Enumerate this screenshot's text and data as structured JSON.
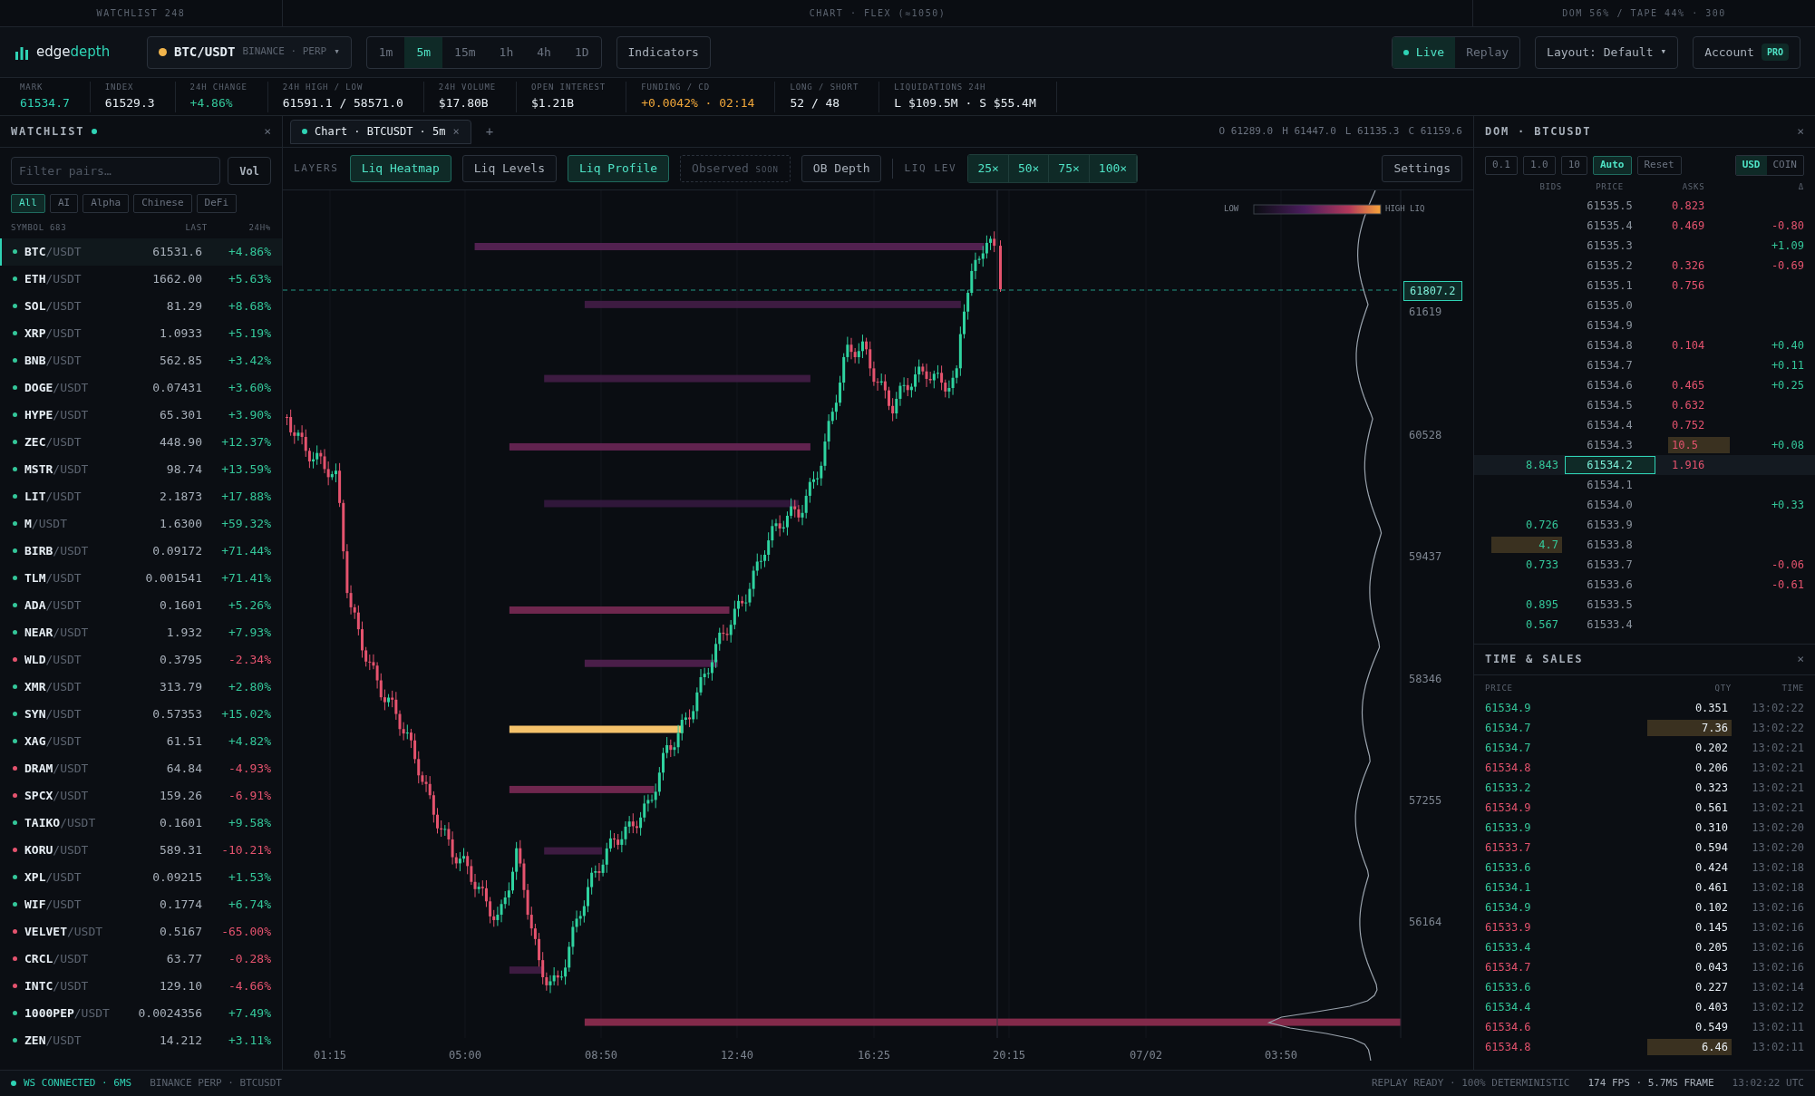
{
  "top_strip": [
    "WATCHLIST 248",
    "CHART · FLEX (≈1050)",
    "DOM 56% / TAPE 44% · 300"
  ],
  "header": {
    "logo": {
      "part_1": "edge",
      "part_2": "depth"
    },
    "symbol": {
      "pair": "BTC/USDT",
      "venue": "BINANCE · PERP",
      "caret": "▾"
    },
    "timeframes": [
      {
        "label": "1m",
        "selected": false
      },
      {
        "label": "5m",
        "selected": true
      },
      {
        "label": "15m",
        "selected": false
      },
      {
        "label": "1h",
        "selected": false
      },
      {
        "label": "4h",
        "selected": false
      },
      {
        "label": "1D",
        "selected": false
      }
    ],
    "indicators": "Indicators",
    "modes": [
      {
        "label": "Live",
        "selected": true
      },
      {
        "label": "Replay",
        "selected": false
      }
    ],
    "layout": "Layout: Default",
    "layout_caret": "▾",
    "account": "Account",
    "account_badge": "PRO"
  },
  "stats": [
    {
      "label": "MARK",
      "value": "61534.7",
      "color": "#2fd3b5"
    },
    {
      "label": "INDEX",
      "value": "61529.3",
      "color": "#e6edf3"
    },
    {
      "label": "24H CHANGE",
      "value": "+4.86%",
      "color": "#34c79a"
    },
    {
      "label": "24H HIGH / LOW",
      "value": "61591.1 / 58571.0",
      "color": "#e6edf3"
    },
    {
      "label": "24H VOLUME",
      "value": "$17.80B",
      "color": "#e6edf3"
    },
    {
      "label": "OPEN INTEREST",
      "value": "$1.21B",
      "color": "#e6edf3"
    },
    {
      "label": "FUNDING / CD",
      "value": "+0.0042% · 02:14",
      "color": "#f0a73a"
    },
    {
      "label": "LONG / SHORT",
      "value": "52 / 48",
      "color": "#e6edf3"
    },
    {
      "label": "LIQUIDATIONS 24H",
      "value": "L $109.5M · S $55.4M",
      "color": "#e6edf3"
    }
  ],
  "watchlist": {
    "title": "WATCHLIST",
    "close": "×",
    "filter": {
      "placeholder": "Filter pairs…"
    },
    "sort_button": "Vol",
    "chips": [
      {
        "label": "All",
        "selected": true
      },
      {
        "label": "AI",
        "selected": false
      },
      {
        "label": "Alpha",
        "selected": false
      },
      {
        "label": "Chinese",
        "selected": false
      },
      {
        "label": "DeFi",
        "selected": false
      }
    ],
    "columns": [
      "SYMBOL 683",
      "LAST",
      "24H%"
    ],
    "rows": [
      {
        "base": "BTC",
        "quote": "/USDT",
        "last": "61531.6",
        "change": "+4.86%",
        "color": "#34c79a",
        "selected": true
      },
      {
        "base": "ETH",
        "quote": "/USDT",
        "last": "1662.00",
        "change": "+5.63%",
        "color": "#34c79a",
        "selected": false
      },
      {
        "base": "SOL",
        "quote": "/USDT",
        "last": "81.29",
        "change": "+8.68%",
        "color": "#34c79a",
        "selected": false
      },
      {
        "base": "XRP",
        "quote": "/USDT",
        "last": "1.0933",
        "change": "+5.19%",
        "color": "#34c79a",
        "selected": false
      },
      {
        "base": "BNB",
        "quote": "/USDT",
        "last": "562.85",
        "change": "+3.42%",
        "color": "#34c79a",
        "selected": false
      },
      {
        "base": "DOGE",
        "quote": "/USDT",
        "last": "0.07431",
        "change": "+3.60%",
        "color": "#34c79a",
        "selected": false
      },
      {
        "base": "HYPE",
        "quote": "/USDT",
        "last": "65.301",
        "change": "+3.90%",
        "color": "#34c79a",
        "selected": false
      },
      {
        "base": "ZEC",
        "quote": "/USDT",
        "last": "448.90",
        "change": "+12.37%",
        "color": "#34c79a",
        "selected": false
      },
      {
        "base": "MSTR",
        "quote": "/USDT",
        "last": "98.74",
        "change": "+13.59%",
        "color": "#34c79a",
        "selected": false
      },
      {
        "base": "LIT",
        "quote": "/USDT",
        "last": "2.1873",
        "change": "+17.88%",
        "color": "#34c79a",
        "selected": false
      },
      {
        "base": "M",
        "quote": "/USDT",
        "last": "1.6300",
        "change": "+59.32%",
        "color": "#34c79a",
        "selected": false
      },
      {
        "base": "BIRB",
        "quote": "/USDT",
        "last": "0.09172",
        "change": "+71.44%",
        "color": "#34c79a",
        "selected": false
      },
      {
        "base": "TLM",
        "quote": "/USDT",
        "last": "0.001541",
        "change": "+71.41%",
        "color": "#34c79a",
        "selected": false
      },
      {
        "base": "ADA",
        "quote": "/USDT",
        "last": "0.1601",
        "change": "+5.26%",
        "color": "#34c79a",
        "selected": false
      },
      {
        "base": "NEAR",
        "quote": "/USDT",
        "last": "1.932",
        "change": "+7.93%",
        "color": "#34c79a",
        "selected": false
      },
      {
        "base": "WLD",
        "quote": "/USDT",
        "last": "0.3795",
        "change": "-2.34%",
        "color": "#e5536e",
        "selected": false
      },
      {
        "base": "XMR",
        "quote": "/USDT",
        "last": "313.79",
        "change": "+2.80%",
        "color": "#34c79a",
        "selected": false
      },
      {
        "base": "SYN",
        "quote": "/USDT",
        "last": "0.57353",
        "change": "+15.02%",
        "color": "#34c79a",
        "selected": false
      },
      {
        "base": "XAG",
        "quote": "/USDT",
        "last": "61.51",
        "change": "+4.82%",
        "color": "#34c79a",
        "selected": false
      },
      {
        "base": "DRAM",
        "quote": "/USDT",
        "last": "64.84",
        "change": "-4.93%",
        "color": "#e5536e",
        "selected": false
      },
      {
        "base": "SPCX",
        "quote": "/USDT",
        "last": "159.26",
        "change": "-6.91%",
        "color": "#e5536e",
        "selected": false
      },
      {
        "base": "TAIKO",
        "quote": "/USDT",
        "last": "0.1601",
        "change": "+9.58%",
        "color": "#34c79a",
        "selected": false
      },
      {
        "base": "KORU",
        "quote": "/USDT",
        "last": "589.31",
        "change": "-10.21%",
        "color": "#e5536e",
        "selected": false
      },
      {
        "base": "XPL",
        "quote": "/USDT",
        "last": "0.09215",
        "change": "+1.53%",
        "color": "#34c79a",
        "selected": false
      },
      {
        "base": "WIF",
        "quote": "/USDT",
        "last": "0.1774",
        "change": "+6.74%",
        "color": "#34c79a",
        "selected": false
      },
      {
        "base": "VELVET",
        "quote": "/USDT",
        "last": "0.5167",
        "change": "-65.00%",
        "color": "#e5536e",
        "selected": false
      },
      {
        "base": "CRCL",
        "quote": "/USDT",
        "last": "63.77",
        "change": "-0.28%",
        "color": "#e5536e",
        "selected": false
      },
      {
        "base": "INTC",
        "quote": "/USDT",
        "last": "129.10",
        "change": "-4.66%",
        "color": "#e5536e",
        "selected": false
      },
      {
        "base": "1000PEP",
        "quote": "/USDT",
        "last": "0.0024356",
        "change": "+7.49%",
        "color": "#34c79a",
        "selected": false
      },
      {
        "base": "ZEN",
        "quote": "/USDT",
        "last": "14.212",
        "change": "+3.11%",
        "color": "#34c79a",
        "selected": false
      }
    ]
  },
  "chart": {
    "tab": {
      "label": "Chart · BTCUSDT · 5m",
      "close": "×"
    },
    "add_tab": "+",
    "ohlc": [
      "O 61289.0",
      "H 61447.0",
      "L 61135.3",
      "C 61159.6"
    ],
    "layers_label": "LAYERS",
    "layers": [
      {
        "label": "Liq Heatmap",
        "kind": "toggle",
        "on": true
      },
      {
        "label": "Liq Levels",
        "kind": "toggle",
        "on": false
      },
      {
        "label": "Liq Profile",
        "kind": "toggle",
        "on": true
      },
      {
        "label": "Observed",
        "kind": "soon",
        "badge": "SOON",
        "on": false
      },
      {
        "label": "OB Depth",
        "kind": "toggle",
        "on": false
      }
    ],
    "leverage_label": "LIQ LEV",
    "leverage": [
      {
        "label": "25×",
        "on": true
      },
      {
        "label": "50×",
        "on": true
      },
      {
        "label": "75×",
        "on": true
      },
      {
        "label": "100×",
        "on": true
      }
    ],
    "settings": "Settings",
    "legend": {
      "low": "LOW",
      "high": "HIGH LIQ"
    },
    "price_tag": "61807.2",
    "price_axis": [
      "61619",
      "60528",
      "59437",
      "58346",
      "57255",
      "56164"
    ],
    "time_axis": [
      "01:15",
      "05:00",
      "08:50",
      "12:40",
      "16:25",
      "20:15",
      "07/02",
      "03:50"
    ]
  },
  "dom": {
    "title": "DOM · BTCUSDT",
    "close": "×",
    "steps": [
      {
        "label": "0.1",
        "selected": false
      },
      {
        "label": "1.0",
        "selected": false
      },
      {
        "label": "10",
        "selected": false
      },
      {
        "label": "Auto",
        "selected": true
      }
    ],
    "reset": "Reset",
    "units": [
      {
        "label": "USD",
        "selected": true
      },
      {
        "label": "COIN",
        "selected": false
      }
    ],
    "columns": [
      "BIDS",
      "PRICE",
      "ASKS",
      "Δ"
    ],
    "rows": [
      {
        "price": "61535.5",
        "ask": "0.823",
        "large": false,
        "selected": false
      },
      {
        "price": "61535.4",
        "ask": "0.469",
        "delta": "-0.80",
        "color": "#e5536e",
        "large": false,
        "selected": false
      },
      {
        "price": "61535.3",
        "delta": "+1.09",
        "color": "#34c79a",
        "selected": false
      },
      {
        "price": "61535.2",
        "ask": "0.326",
        "delta": "-0.69",
        "color": "#e5536e",
        "large": false,
        "selected": false
      },
      {
        "price": "61535.1",
        "ask": "0.756",
        "large": false,
        "selected": false
      },
      {
        "price": "61535.0",
        "selected": false
      },
      {
        "price": "61534.9",
        "selected": false
      },
      {
        "price": "61534.8",
        "ask": "0.104",
        "delta": "+0.40",
        "color": "#34c79a",
        "large": false,
        "selected": false
      },
      {
        "price": "61534.7",
        "delta": "+0.11",
        "color": "#34c79a",
        "selected": false
      },
      {
        "price": "61534.6",
        "ask": "0.465",
        "delta": "+0.25",
        "color": "#34c79a",
        "large": false,
        "selected": false
      },
      {
        "price": "61534.5",
        "ask": "0.632",
        "large": false,
        "selected": false
      },
      {
        "price": "61534.4",
        "ask": "0.752",
        "large": false,
        "selected": false
      },
      {
        "price": "61534.3",
        "ask": "10.5",
        "delta": "+0.08",
        "color": "#34c79a",
        "large": true,
        "selected": false
      },
      {
        "price": "61534.2",
        "bid": "8.843",
        "ask": "1.916",
        "large": false,
        "selected": true
      },
      {
        "price": "61534.1",
        "selected": false
      },
      {
        "price": "61534.0",
        "delta": "+0.33",
        "color": "#34c79a",
        "selected": false
      },
      {
        "price": "61533.9",
        "bid": "0.726",
        "large": false,
        "selected": false
      },
      {
        "price": "61533.8",
        "bid": "4.7",
        "large": true,
        "selected": false
      },
      {
        "price": "61533.7",
        "bid": "0.733",
        "delta": "-0.06",
        "color": "#e5536e",
        "large": false,
        "selected": false
      },
      {
        "price": "61533.6",
        "delta": "-0.61",
        "color": "#e5536e",
        "selected": false
      },
      {
        "price": "61533.5",
        "bid": "0.895",
        "large": false,
        "selected": false
      },
      {
        "price": "61533.4",
        "bid": "0.567",
        "large": false,
        "selected": false
      }
    ]
  },
  "time_sales": {
    "title": "TIME & SALES",
    "close": "×",
    "columns": [
      "PRICE",
      "QTY",
      "TIME"
    ],
    "rows": [
      {
        "price": "61534.9",
        "qty": "0.351",
        "time": "13:02:22",
        "color": "#34c79a",
        "large": false
      },
      {
        "price": "61534.7",
        "qty": "7.36",
        "time": "13:02:22",
        "color": "#34c79a",
        "large": true
      },
      {
        "price": "61534.7",
        "qty": "0.202",
        "time": "13:02:21",
        "color": "#34c79a",
        "large": false
      },
      {
        "price": "61534.8",
        "qty": "0.206",
        "time": "13:02:21",
        "color": "#e5536e",
        "large": false
      },
      {
        "price": "61533.2",
        "qty": "0.323",
        "time": "13:02:21",
        "color": "#34c79a",
        "large": false
      },
      {
        "price": "61534.9",
        "qty": "0.561",
        "time": "13:02:21",
        "color": "#e5536e",
        "large": false
      },
      {
        "price": "61533.9",
        "qty": "0.310",
        "time": "13:02:20",
        "color": "#34c79a",
        "large": false
      },
      {
        "price": "61533.7",
        "qty": "0.594",
        "time": "13:02:20",
        "color": "#e5536e",
        "large": false
      },
      {
        "price": "61533.6",
        "qty": "0.424",
        "time": "13:02:18",
        "color": "#34c79a",
        "large": false
      },
      {
        "price": "61534.1",
        "qty": "0.461",
        "time": "13:02:18",
        "color": "#34c79a",
        "large": false
      },
      {
        "price": "61534.9",
        "qty": "0.102",
        "time": "13:02:16",
        "color": "#34c79a",
        "large": false
      },
      {
        "price": "61533.9",
        "qty": "0.145",
        "time": "13:02:16",
        "color": "#e5536e",
        "large": false
      },
      {
        "price": "61533.4",
        "qty": "0.205",
        "time": "13:02:16",
        "color": "#34c79a",
        "large": false
      },
      {
        "price": "61534.7",
        "qty": "0.043",
        "time": "13:02:16",
        "color": "#e5536e",
        "large": false
      },
      {
        "price": "61533.6",
        "qty": "0.227",
        "time": "13:02:14",
        "color": "#34c79a",
        "large": false
      },
      {
        "price": "61534.4",
        "qty": "0.403",
        "time": "13:02:12",
        "color": "#34c79a",
        "large": false
      },
      {
        "price": "61534.6",
        "qty": "0.549",
        "time": "13:02:11",
        "color": "#e5536e",
        "large": false
      },
      {
        "price": "61534.8",
        "qty": "6.46",
        "time": "13:02:11",
        "color": "#e5536e",
        "large": true
      }
    ]
  },
  "status": {
    "connection": "WS CONNECTED · 6MS",
    "connected": true,
    "feed": "BINANCE PERP · BTCUSDT",
    "replay": "REPLAY READY · 100% DETERMINISTIC",
    "fps": "174 FPS · 5.7MS FRAME",
    "clock": "13:02:22 UTC"
  }
}
